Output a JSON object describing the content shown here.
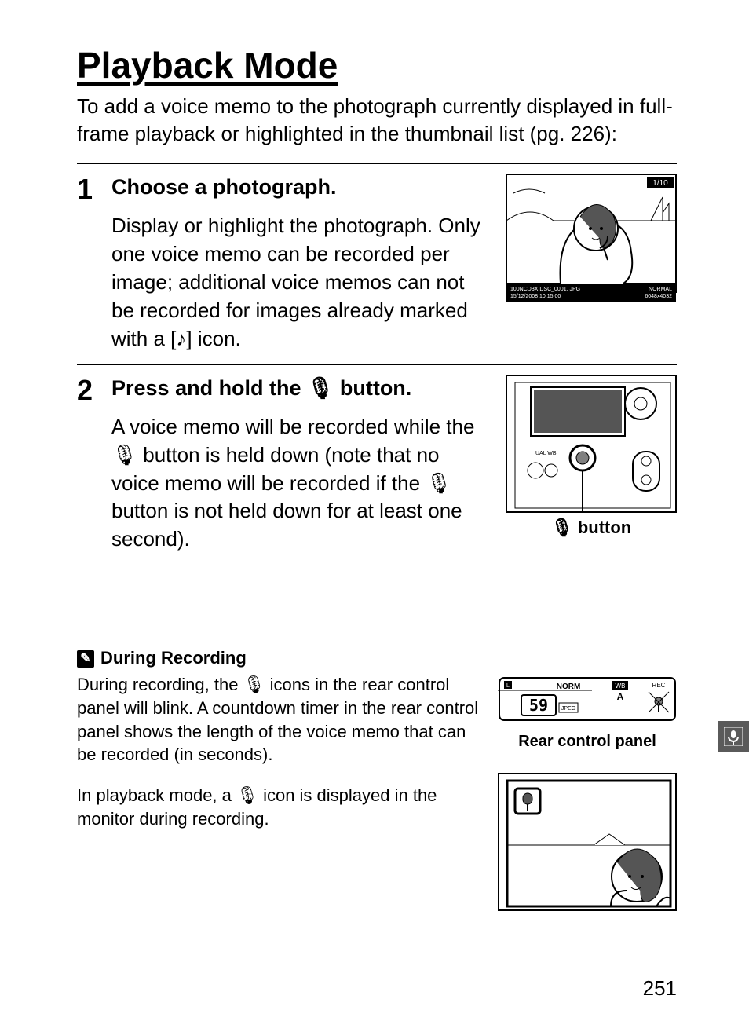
{
  "title": "Playback Mode",
  "intro": "To add a voice memo to the photograph currently displayed in full-frame playback or highlighted in the thumbnail list (pg. 226):",
  "steps": [
    {
      "num": "1",
      "title": "Choose a photograph.",
      "text_a": "Display or highlight the photograph. Only one voice memo can be recorded per image; additional voice memos can not be recorded for images already marked with a ",
      "text_b": " icon.",
      "fig": {
        "counter": "1/10",
        "info1": "100NCD3X  DSC_0001. JPG",
        "info2": "15/12/2008  10:15:00",
        "info3": "NORMAL",
        "info4": "6048x4032"
      }
    },
    {
      "num": "2",
      "title_a": "Press and hold the ",
      "title_b": " button.",
      "text_a": "A voice memo will be recorded while the ",
      "text_b": " button is held down (note that no voice memo will be recorded if the  ",
      "text_c": " button is not held down for at least one second).",
      "caption_a": " button"
    }
  ],
  "note": {
    "title": "During Recording",
    "p1_a": "During recording, the ",
    "p1_b": " icons in the rear control panel will blink.  A countdown timer in the rear control panel shows the length of the voice memo that can be recorded (in seconds).",
    "p2_a": "In playback mode, a ",
    "p2_b": " icon is displayed in the monitor during recording.",
    "caption": "Rear control panel",
    "panel": {
      "norm": "NORM",
      "wb": "WB",
      "a": "A",
      "count": "59",
      "jpeg": "JPEG",
      "rec": "REC"
    }
  },
  "page_number": "251",
  "icons": {
    "mic": "🎙",
    "music": "[♪]",
    "pencil": "✎"
  }
}
